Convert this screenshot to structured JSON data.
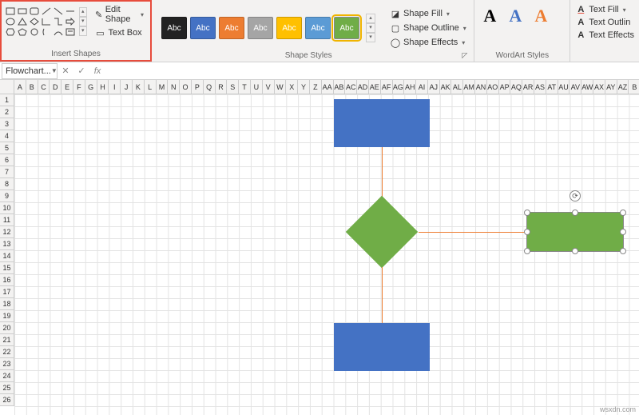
{
  "ribbon": {
    "insert_shapes": {
      "label": "Insert Shapes",
      "edit_shape": "Edit Shape",
      "text_box": "Text Box"
    },
    "shape_styles": {
      "label": "Shape Styles",
      "swatches": [
        {
          "bg": "#222",
          "txt": "Abc"
        },
        {
          "bg": "#4472c4",
          "txt": "Abc"
        },
        {
          "bg": "#ed7d31",
          "txt": "Abc"
        },
        {
          "bg": "#a5a5a5",
          "txt": "Abc"
        },
        {
          "bg": "#ffc000",
          "txt": "Abc"
        },
        {
          "bg": "#5b9bd5",
          "txt": "Abc"
        },
        {
          "bg": "#70ad47",
          "txt": "Abc"
        }
      ],
      "fill": "Shape Fill",
      "outline": "Shape Outline",
      "effects": "Shape Effects"
    },
    "wordart": {
      "label": "WordArt Styles",
      "text_fill": "Text Fill",
      "text_outline": "Text Outlin",
      "text_effects": "Text Effects"
    }
  },
  "namebox": {
    "value": "Flowchart..."
  },
  "columns": [
    "A",
    "B",
    "C",
    "D",
    "E",
    "F",
    "G",
    "H",
    "I",
    "J",
    "K",
    "L",
    "M",
    "N",
    "O",
    "P",
    "Q",
    "R",
    "S",
    "T",
    "U",
    "V",
    "W",
    "X",
    "Y",
    "Z",
    "AA",
    "AB",
    "AC",
    "AD",
    "AE",
    "AF",
    "AG",
    "AH",
    "AI",
    "AJ",
    "AK",
    "AL",
    "AM",
    "AN",
    "AO",
    "AP",
    "AQ",
    "AR",
    "AS",
    "AT",
    "AU",
    "AV",
    "AW",
    "AX",
    "AY",
    "AZ",
    "B"
  ],
  "rows": [
    "1",
    "2",
    "3",
    "4",
    "5",
    "6",
    "7",
    "8",
    "9",
    "10",
    "11",
    "12",
    "13",
    "14",
    "15",
    "16",
    "17",
    "18",
    "19",
    "20",
    "21",
    "22",
    "23",
    "24",
    "25",
    "26"
  ],
  "watermark": "wsxdn.com"
}
